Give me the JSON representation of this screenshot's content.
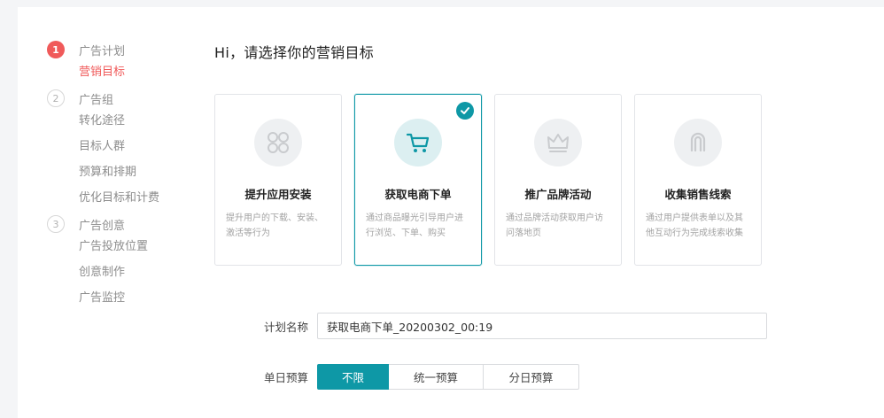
{
  "colors": {
    "accent": "#0e98a6",
    "active_step": "#f05a5a",
    "muted_text": "#8d8d8d"
  },
  "sidebar": {
    "steps": [
      {
        "number": "1",
        "title": "广告计划",
        "active": true,
        "items": [
          {
            "label": "营销目标",
            "active": true
          }
        ]
      },
      {
        "number": "2",
        "title": "广告组",
        "active": false,
        "items": [
          {
            "label": "转化途径"
          },
          {
            "label": "目标人群"
          },
          {
            "label": "预算和排期"
          },
          {
            "label": "优化目标和计费"
          }
        ]
      },
      {
        "number": "3",
        "title": "广告创意",
        "active": false,
        "items": [
          {
            "label": "广告投放位置"
          },
          {
            "label": "创意制作"
          },
          {
            "label": "广告监控"
          }
        ]
      }
    ]
  },
  "main": {
    "title": "Hi，请选择你的营销目标",
    "cards": [
      {
        "icon": "app-grid-icon",
        "title": "提升应用安装",
        "desc": "提升用户的下载、安装、激活等行为",
        "selected": false
      },
      {
        "icon": "shopping-cart-icon",
        "title": "获取电商下单",
        "desc": "通过商品曝光引导用户进行浏览、下单、购买",
        "selected": true
      },
      {
        "icon": "crown-icon",
        "title": "推广品牌活动",
        "desc": "通过品牌活动获取用户访问落地页",
        "selected": false
      },
      {
        "icon": "magnet-icon",
        "title": "收集销售线索",
        "desc": "通过用户提供表单以及其他互动行为完成线索收集",
        "selected": false
      }
    ],
    "form": {
      "plan_name_label": "计划名称",
      "plan_name_value": "获取电商下单_20200302_00:19",
      "daily_budget_label": "单日预算",
      "budget_options": [
        {
          "label": "不限",
          "active": true
        },
        {
          "label": "统一预算",
          "active": false
        },
        {
          "label": "分日预算",
          "active": false
        }
      ]
    }
  }
}
